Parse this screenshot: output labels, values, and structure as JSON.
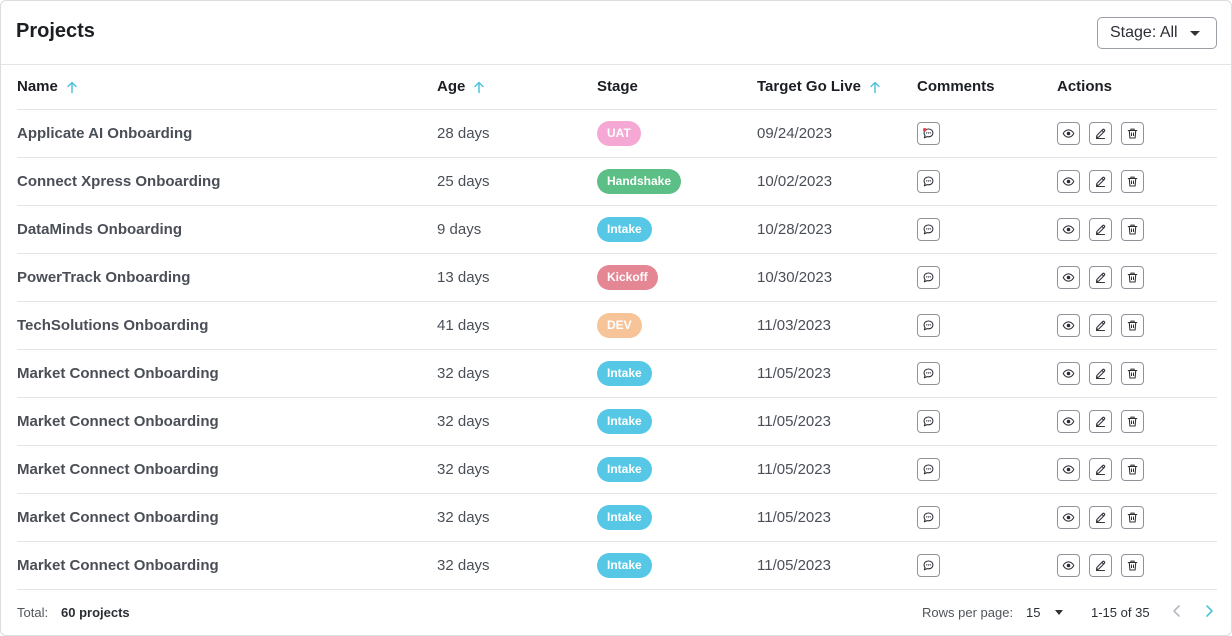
{
  "header": {
    "title": "Projects",
    "stage_filter_label": "Stage: All"
  },
  "table": {
    "columns": [
      {
        "label": "Name",
        "sorted": true
      },
      {
        "label": "Age",
        "sorted": true
      },
      {
        "label": "Stage",
        "sorted": false
      },
      {
        "label": "Target Go Live",
        "sorted": true
      },
      {
        "label": "Comments",
        "sorted": false
      },
      {
        "label": "Actions",
        "sorted": false
      }
    ],
    "rows": [
      {
        "name": "Applicate AI Onboarding",
        "age": "28 days",
        "stage": "UAT",
        "target": "09/24/2023",
        "unread": true
      },
      {
        "name": "Connect Xpress Onboarding",
        "age": "25 days",
        "stage": "Handshake",
        "target": "10/02/2023",
        "unread": false
      },
      {
        "name": "DataMinds Onboarding",
        "age": "9 days",
        "stage": "Intake",
        "target": "10/28/2023",
        "unread": false
      },
      {
        "name": "PowerTrack Onboarding",
        "age": "13 days",
        "stage": "Kickoff",
        "target": "10/30/2023",
        "unread": false
      },
      {
        "name": "TechSolutions Onboarding",
        "age": "41 days",
        "stage": "DEV",
        "target": "11/03/2023",
        "unread": false
      },
      {
        "name": "Market Connect Onboarding",
        "age": "32 days",
        "stage": "Intake",
        "target": "11/05/2023",
        "unread": false
      },
      {
        "name": "Market Connect Onboarding",
        "age": "32 days",
        "stage": "Intake",
        "target": "11/05/2023",
        "unread": false
      },
      {
        "name": "Market Connect Onboarding",
        "age": "32 days",
        "stage": "Intake",
        "target": "11/05/2023",
        "unread": false
      },
      {
        "name": "Market Connect Onboarding",
        "age": "32 days",
        "stage": "Intake",
        "target": "11/05/2023",
        "unread": false
      },
      {
        "name": "Market Connect Onboarding",
        "age": "32 days",
        "stage": "Intake",
        "target": "11/05/2023",
        "unread": false
      }
    ]
  },
  "stage_colors": {
    "UAT": "#f6a8d4",
    "Handshake": "#5cbf85",
    "Intake": "#56c8e6",
    "Kickoff": "#e58694",
    "DEV": "#f7c499"
  },
  "colors": {
    "sort_arrow": "#4ec3db",
    "unread_dot": "#e0424e",
    "pager_disabled": "#b5b9be",
    "pager_enabled": "#4ec3db"
  },
  "icons": {
    "comment": "speech-bubble-icon",
    "view": "eye-icon",
    "edit": "pencil-icon",
    "delete": "trash-icon"
  },
  "footer": {
    "total_label": "Total:",
    "total_value": "60 projects",
    "rows_per_page_label": "Rows per page:",
    "rows_per_page_value": "15",
    "range_text": "1-15 of 35"
  }
}
